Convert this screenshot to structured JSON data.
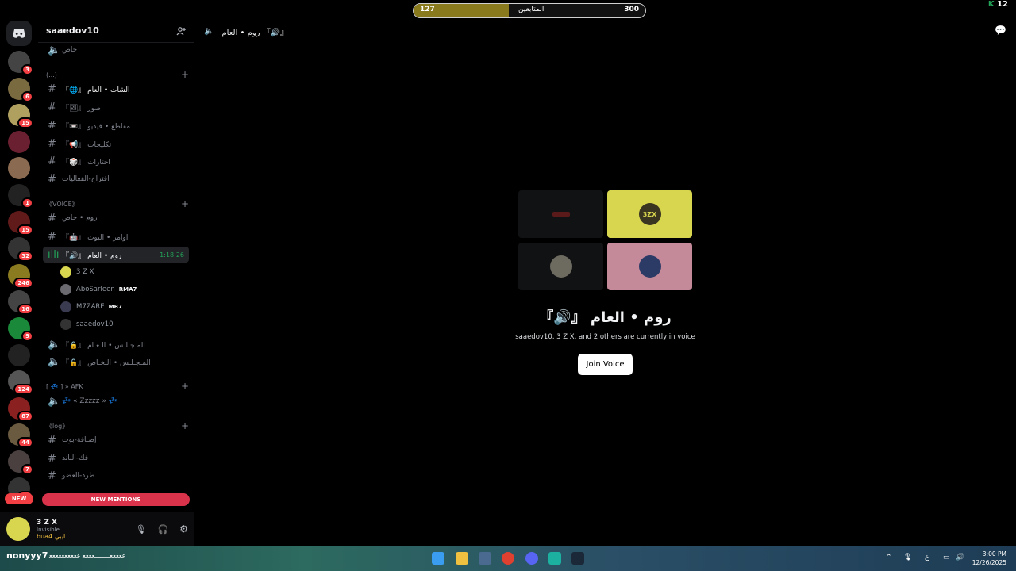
{
  "server": {
    "name": "saaedov10"
  },
  "overlay": {
    "left_value": "127",
    "label": "المتابعين",
    "right_value": "300",
    "progress": 0.41,
    "corner": "12"
  },
  "rail_badges": [
    "3",
    "6",
    "15",
    "",
    "",
    "1",
    "15",
    "32",
    "246",
    "16",
    "9",
    "",
    "124",
    "87",
    "44",
    "7",
    "21"
  ],
  "rail_new": "NEW",
  "channels": {
    "top_voice": "خاص",
    "cat1": "(...)",
    "c1": "『🌐』 الشات • العام",
    "c2": "『🖼』 صور",
    "c3": "『📼』 مقاطع • فيديو",
    "c4": "『📢』 تكليجات",
    "c5": "『🎲』 اختارات",
    "c6": "اقتراح-الفعاليات",
    "cat2": "《VOICE》",
    "v1": "روم • خاص",
    "v2": "『🤖』 اوامر • البوت",
    "v3": "『🔊』 روم • العام",
    "v3_time": "1:18:26",
    "v4": "『🔒』 المـجـلـس • الـعـام",
    "v5": "『🔒』 المـجـلـس • الـخـاص",
    "cat3": "[ 💤 ] » AFK",
    "afk": "💤 « Zzzzz » 💤",
    "cat4": "《log》",
    "l1": "إضـافة-بوت",
    "l2": "فك-الباند",
    "l3": "طرد-العضو"
  },
  "voice_users": [
    {
      "name": "3 Z X",
      "tag": ""
    },
    {
      "name": "AboSarleen",
      "tag": "RMA7"
    },
    {
      "name": "M7ZARE",
      "tag": "MB7"
    },
    {
      "name": "saaedov10",
      "tag": ""
    }
  ],
  "new_mentions": "NEW MENTIONS",
  "user_panel": {
    "name": "3 Z X",
    "status": "Invisible",
    "extra": "bua4 ايبي"
  },
  "main": {
    "header": "روم • العام 『🔊』",
    "title": "『🔊』 روم • العام",
    "subtitle": "saaedov10, 3 Z X, and 2 others are currently in voice",
    "join_label": "Join Voice",
    "tile_label": "3ZX"
  },
  "taskbar": {
    "left": "nonyyy7",
    "left2": "ﻋﻌﻌﻌﻌــــــــﻌﻌﻌﻌ ﻋﻌﻌﻌﻌﻌﻌﻌﻌﻌ",
    "lang": "ع",
    "time": "3:00 PM",
    "date": "12/26/2025"
  },
  "colors": {
    "accent_red": "#f23f43",
    "online_green": "#23a559",
    "tile_yellow": "#d8d54f",
    "tile_pink": "#c48a9a"
  }
}
